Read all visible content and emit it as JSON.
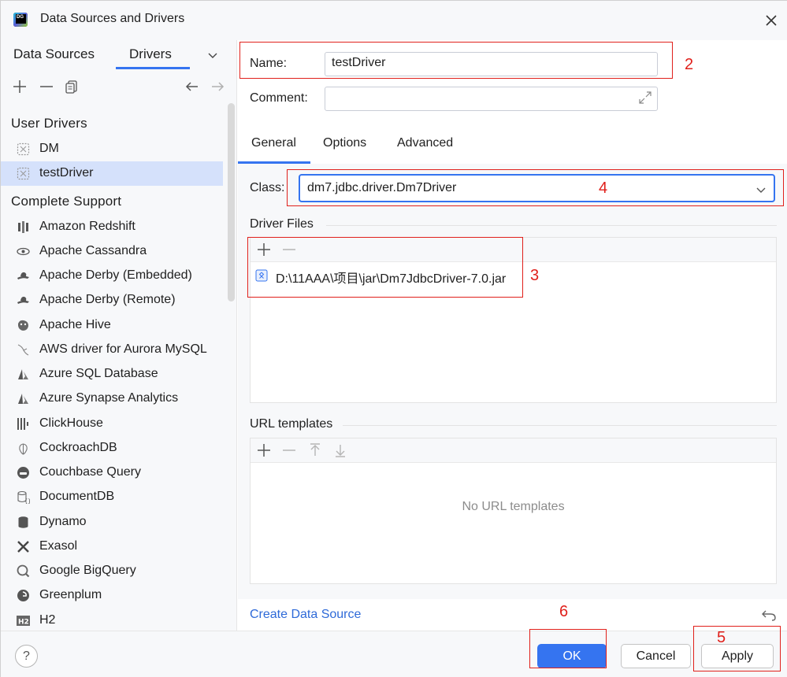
{
  "window": {
    "title": "Data Sources and Drivers",
    "app_icon": "datagrip-logo-icon",
    "close_icon": "close-icon"
  },
  "left": {
    "tabs": [
      {
        "label": "Data Sources"
      },
      {
        "label": "Drivers",
        "active": true
      }
    ],
    "toolbar_icons": [
      "add-icon",
      "remove-icon",
      "duplicate-icon",
      "back-arrow-icon",
      "forward-arrow-icon"
    ],
    "sections": [
      {
        "title": "User Drivers",
        "items": [
          {
            "label": "DM",
            "icon": "custom-driver-icon"
          },
          {
            "label": "testDriver",
            "icon": "custom-driver-icon",
            "selected": true
          }
        ]
      },
      {
        "title": "Complete Support",
        "items": [
          {
            "label": "Amazon Redshift",
            "icon": "redshift-icon"
          },
          {
            "label": "Apache Cassandra",
            "icon": "cassandra-eye-icon"
          },
          {
            "label": "Apache Derby (Embedded)",
            "icon": "derby-hat-icon"
          },
          {
            "label": "Apache Derby (Remote)",
            "icon": "derby-hat-icon"
          },
          {
            "label": "Apache Hive",
            "icon": "hive-icon"
          },
          {
            "label": "AWS driver for Aurora MySQL",
            "icon": "mysql-dolphin-icon"
          },
          {
            "label": "Azure SQL Database",
            "icon": "azure-icon"
          },
          {
            "label": "Azure Synapse Analytics",
            "icon": "azure-icon"
          },
          {
            "label": "ClickHouse",
            "icon": "clickhouse-bars-icon"
          },
          {
            "label": "CockroachDB",
            "icon": "cockroach-icon"
          },
          {
            "label": "Couchbase Query",
            "icon": "couchbase-icon"
          },
          {
            "label": "DocumentDB",
            "icon": "documentdb-icon"
          },
          {
            "label": "Dynamo",
            "icon": "dynamo-icon"
          },
          {
            "label": "Exasol",
            "icon": "exasol-x-icon"
          },
          {
            "label": "Google BigQuery",
            "icon": "bigquery-icon"
          },
          {
            "label": "Greenplum",
            "icon": "greenplum-icon"
          },
          {
            "label": "H2",
            "icon": "h2-icon"
          }
        ]
      }
    ]
  },
  "form": {
    "name_label": "Name:",
    "name_value": "testDriver",
    "comment_label": "Comment:",
    "comment_value": "",
    "tabs": [
      {
        "label": "General",
        "active": true
      },
      {
        "label": "Options"
      },
      {
        "label": "Advanced"
      }
    ],
    "class_label": "Class:",
    "class_value": "dm7.jdbc.driver.Dm7Driver",
    "driver_files_title": "Driver Files",
    "driver_files": [
      {
        "path": "D:\\11AAA\\项目\\jar\\Dm7JdbcDriver-7.0.jar",
        "icon": "jar-file-icon"
      }
    ],
    "url_templates_title": "URL templates",
    "url_templates_empty": "No URL templates",
    "create_link": "Create Data Source"
  },
  "buttons": {
    "ok": "OK",
    "cancel": "Cancel",
    "apply": "Apply",
    "help": "?"
  },
  "annotations": {
    "colors": {
      "annotation": "#e0201b",
      "accent": "#3574f0",
      "selection": "#d5e1fb"
    },
    "labels": [
      "2",
      "3",
      "4",
      "5",
      "6"
    ]
  }
}
